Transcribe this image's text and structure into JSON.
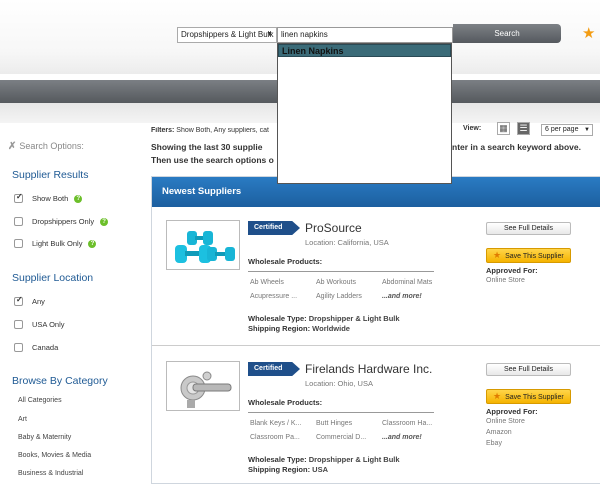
{
  "header": {
    "category_select": "Dropshippers & Light Bulk",
    "search_value": "linen napkins",
    "search_button": "Search"
  },
  "autocomplete": {
    "suggestions": [
      "Linen Napkins"
    ]
  },
  "sidebar": {
    "search_options": "Search Options:",
    "supplier_results": {
      "heading": "Supplier Results",
      "items": [
        {
          "label": "Show Both",
          "checked": true
        },
        {
          "label": "Dropshippers Only",
          "checked": false
        },
        {
          "label": "Light Bulk Only",
          "checked": false
        }
      ]
    },
    "supplier_location": {
      "heading": "Supplier Location",
      "items": [
        {
          "label": "Any",
          "checked": true
        },
        {
          "label": "USA Only",
          "checked": false
        },
        {
          "label": "Canada",
          "checked": false
        }
      ]
    },
    "browse": {
      "heading": "Browse By Category",
      "items": [
        "All Categories",
        "Art",
        "Baby & Maternity",
        "Books, Movies & Media",
        "Business & Industrial"
      ]
    }
  },
  "main": {
    "filters_label": "Filters:",
    "filters_text": "Show Both, Any suppliers, cat",
    "showing_line1_a": "Showing the last 30 supplie",
    "showing_line1_b": "nter in a search keyword above.",
    "showing_line2": "Then use the search options o",
    "view_label": "View:",
    "per_page": "6 per page",
    "panel_title": "Newest Suppliers",
    "certified_label": "Certified",
    "wholesale_products_label": "Wholesale Products:",
    "wholesale_type_label": "Wholesale Type:",
    "shipping_region_label": "Shipping Region:",
    "see_details_label": "See Full Details",
    "save_label": "Save This Supplier",
    "approved_label": "Approved For:",
    "suppliers": [
      {
        "name": "ProSource",
        "location": "Location: California, USA",
        "products": [
          "Ab Wheels",
          "Ab Workouts",
          "Abdominal Mats",
          "Acupressure ...",
          "Agility Ladders",
          "...and more!"
        ],
        "wholesale_type": "Dropshipper & Light Bulk",
        "shipping_region": "Worldwide",
        "approved_for": [
          "Online Store"
        ]
      },
      {
        "name": "Firelands Hardware Inc.",
        "location": "Location: Ohio, USA",
        "products": [
          "Blank Keys / K...",
          "Butt Hinges",
          "Classroom Ha...",
          "Classroom Pa...",
          "Commercial D...",
          "...and more!"
        ],
        "wholesale_type": "Dropshipper & Light Bulk",
        "shipping_region": "USA",
        "approved_for": [
          "Online Store",
          "Amazon",
          "Ebay"
        ]
      }
    ]
  },
  "colors": {
    "accent_blue": "#1f5a94",
    "panel_header": "#2a7bc3",
    "certified_badge": "#1f4f8a",
    "save_button": "#f5b300",
    "autocomplete_highlight": "#3b6b78"
  }
}
